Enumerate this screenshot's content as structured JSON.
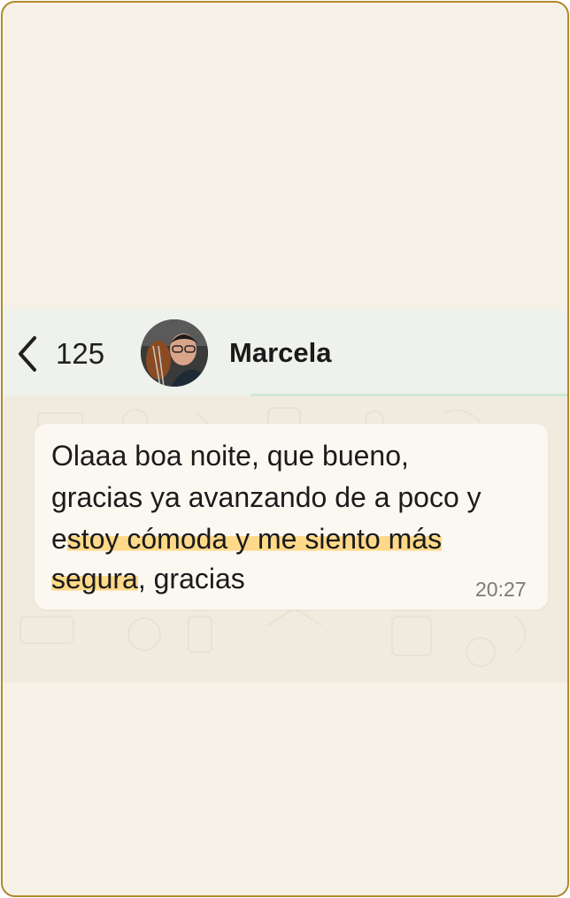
{
  "header": {
    "back_icon": "chevron-left-icon",
    "unread_count": "125",
    "contact_name": "Marcela"
  },
  "message": {
    "line1": "Olaaa boa noite, que bueno,",
    "line2": "gracias ya avanzando de a poco y",
    "line3_pre": "e",
    "line3_hl": "stoy cómoda y me siento más",
    "line4_hl": "segura",
    "line4_post": ", gracias",
    "time": "20:27"
  },
  "colors": {
    "frame": "#b08a2e",
    "highlight": "#ffd98a",
    "background": "#f6f1e6"
  }
}
